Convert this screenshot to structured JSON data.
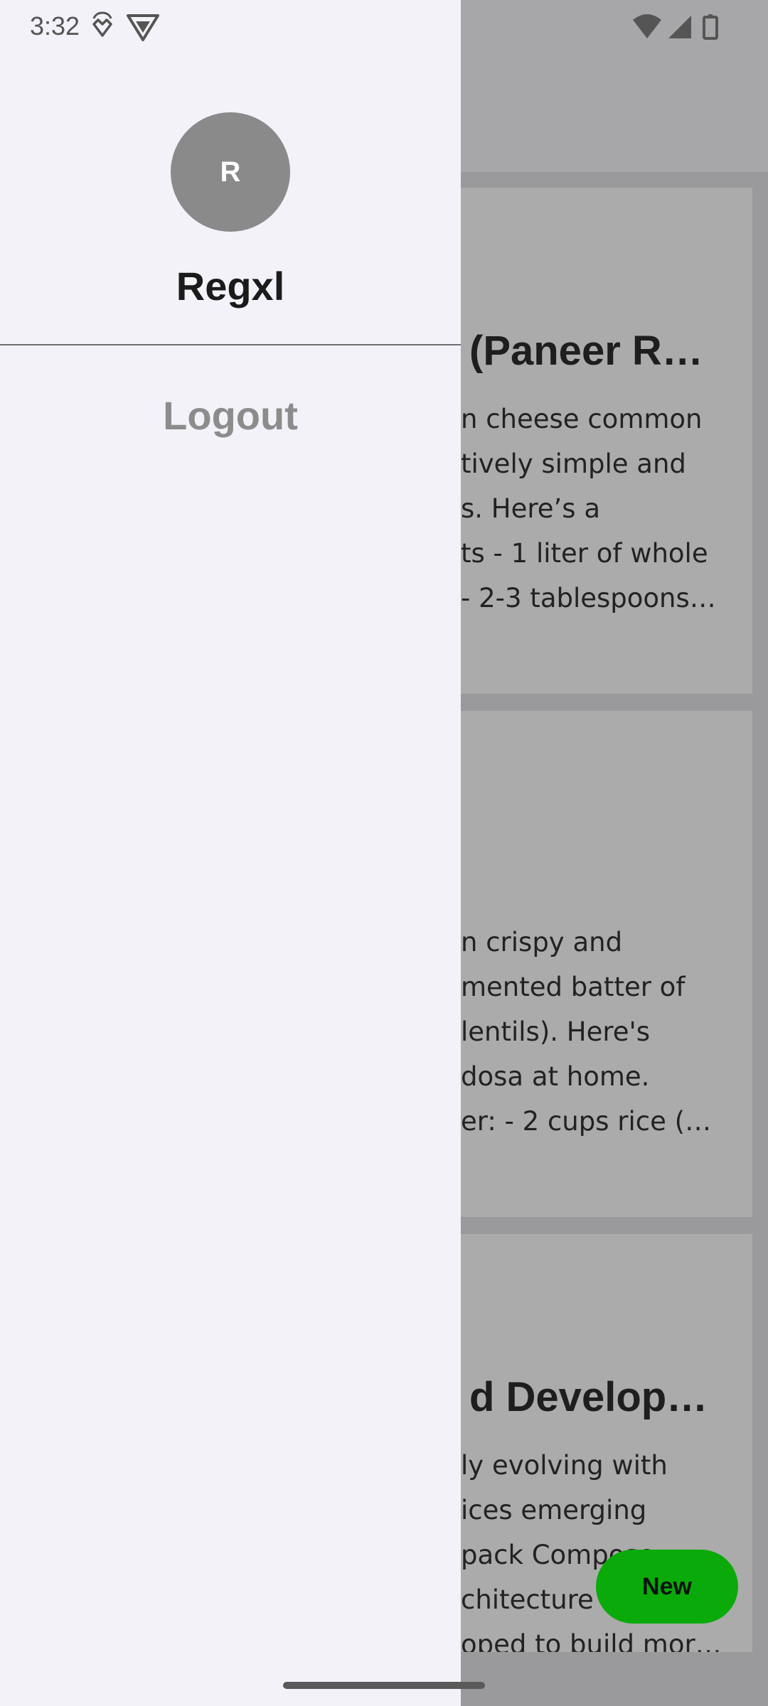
{
  "status_bar": {
    "time": "3:32",
    "left_icons": [
      "shield-heart-icon",
      "vpn-shield-icon"
    ],
    "right_icons": [
      "wifi-icon",
      "signal-icon",
      "battery-icon"
    ]
  },
  "drawer": {
    "avatar_initial": "R",
    "username": "Regxl",
    "logout_label": "Logout"
  },
  "background_app": {
    "cards": [
      {
        "title": "(Paneer R…",
        "lines": [
          "n cheese common",
          "tively simple and",
          "s. Here’s a",
          "ts - 1 liter of whole",
          "- 2-3 tablespoons…"
        ]
      },
      {
        "title": "",
        "lines": [
          "n crispy and",
          "mented batter of",
          "lentils). Here's",
          "dosa at home.",
          "er: - 2 cups rice (…"
        ]
      },
      {
        "title": "d Develop…",
        "lines": [
          "ly evolving with",
          "ices emerging",
          "pack Compose",
          "chitecture",
          "oped to build mor…"
        ]
      }
    ],
    "fab_label": "New"
  },
  "colors": {
    "drawer_bg": "#f3f2f8",
    "fab_green": "#0aaa0a",
    "avatar_gray": "#8a8a8a"
  }
}
